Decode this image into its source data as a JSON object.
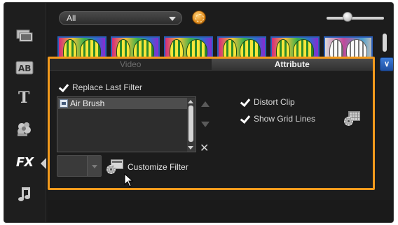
{
  "library": {
    "filter_dropdown": {
      "selected": "All"
    }
  },
  "sidebar": {
    "items": [
      {
        "name": "media",
        "icon": "media-library-icon"
      },
      {
        "name": "title-template",
        "icon": "ab-text-icon",
        "label": "AB"
      },
      {
        "name": "title",
        "icon": "title-t-icon",
        "label": "T"
      },
      {
        "name": "graphic",
        "icon": "graphic-flower-icon"
      },
      {
        "name": "filter",
        "icon": "fx-icon",
        "label": "FX",
        "active": true
      },
      {
        "name": "audio",
        "icon": "music-note-icon"
      }
    ]
  },
  "tabs": [
    {
      "label": "Video",
      "active": false
    },
    {
      "label": "Attribute",
      "active": true
    }
  ],
  "attribute": {
    "replace_last_filter": {
      "label": "Replace Last Filter",
      "checked": true
    },
    "applied_filters": [
      {
        "label": "Air Brush",
        "selected": true
      }
    ],
    "customize_filter": {
      "label": "Customize Filter"
    },
    "distort_clip": {
      "label": "Distort Clip",
      "checked": true
    },
    "show_grid_lines": {
      "label": "Show Grid Lines",
      "checked": true
    }
  },
  "colors": {
    "accent_outline": "#f39a1c",
    "collapse_button": "#2f64c0",
    "thumbnail_border": "#2b5fb8"
  }
}
